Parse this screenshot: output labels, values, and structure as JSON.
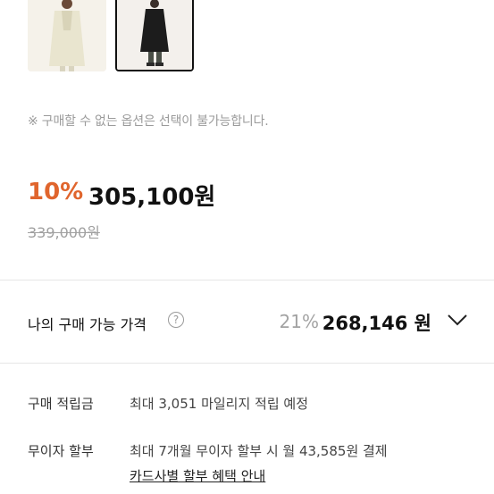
{
  "notice": "※ 구매할 수 없는 옵션은 선택이 불가능합니다.",
  "price": {
    "discount": "10%",
    "sale": "305,100원",
    "original": "339,000원"
  },
  "my_price": {
    "label": "나의 구매 가능 가격",
    "help_icon": "?",
    "discount": "21%",
    "price": "268,146 원"
  },
  "info": {
    "points_label": "구매 적립금",
    "points_value": "최대 3,051 마일리지 적립 예정",
    "installment_label": "무이자 할부",
    "installment_value": "최대 7개월 무이자 할부 시 월 43,585원 결제",
    "installment_link": "카드사별 할부 혜택 안내"
  },
  "colors": {
    "discount": "#e0652d",
    "muted": "#a0a0a0"
  }
}
